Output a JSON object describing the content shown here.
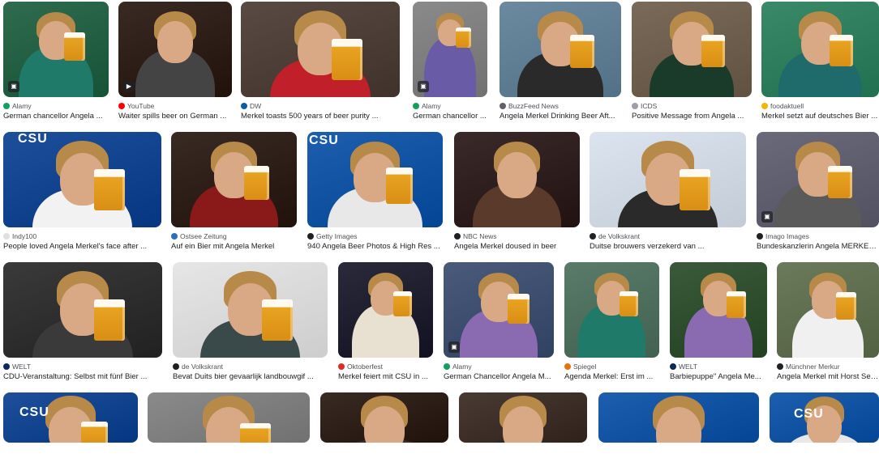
{
  "results": [
    {
      "source": "Alamy",
      "caption": "German chancellor Angela ...",
      "favicon_color": "#12a05c",
      "badge": "image",
      "bg": "#2f6b4e",
      "body": "#1f7a6a",
      "mug": true
    },
    {
      "source": "YouTube",
      "caption": "Waiter spills beer on German ...",
      "favicon_color": "#ff0000",
      "badge": "play",
      "bg": "#3a2a24",
      "body": "#444444",
      "mug": false
    },
    {
      "source": "DW",
      "caption": "Merkel toasts 500 years of beer purity ...",
      "favicon_color": "#0b5da8",
      "badge": "",
      "bg": "#5a4a44",
      "body": "#c0202a",
      "mug": true
    },
    {
      "source": "Alamy",
      "caption": "German chancellor ...",
      "favicon_color": "#12a05c",
      "badge": "image",
      "bg": "#8a8a8a",
      "body": "#6a5ba6",
      "mug": true
    },
    {
      "source": "BuzzFeed News",
      "caption": "Angela Merkel Drinking Beer Aft...",
      "favicon_color": "#5f6368",
      "badge": "",
      "bg": "#6b8aa0",
      "body": "#2a2a2a",
      "mug": true
    },
    {
      "source": "ICDS",
      "caption": "Positive Message from Angela ...",
      "favicon_color": "#9aa0a6",
      "badge": "",
      "bg": "#7a6a5a",
      "body": "#1a3a2a",
      "mug": true
    },
    {
      "source": "foodaktuell",
      "caption": "Merkel setzt auf deutsches Bier ...",
      "favicon_color": "#f4b400",
      "badge": "",
      "bg": "#3a8a6a",
      "body": "#1f6a6a",
      "mug": true
    },
    {
      "source": "Indy100",
      "caption": "People loved Angela Merkel's face after ...",
      "favicon_color": "#e0e0e0",
      "badge": "",
      "bg": "#1d4f9a",
      "body": "#f2f2f2",
      "mug": true
    },
    {
      "source": "Ostsee Zeitung",
      "caption": "Auf ein Bier mit Angela Merkel",
      "favicon_color": "#2a6fb8",
      "badge": "",
      "bg": "#3a2a24",
      "body": "#8a1a1a",
      "mug": true
    },
    {
      "source": "Getty Images",
      "caption": "940 Angela Beer Photos & High Res ...",
      "favicon_color": "#202124",
      "badge": "",
      "bg": "#1d5fae",
      "body": "#e8e8e8",
      "mug": true
    },
    {
      "source": "NBC News",
      "caption": "Angela Merkel doused in beer",
      "favicon_color": "#202124",
      "badge": "",
      "bg": "#3a2a2a",
      "body": "#5a3a2a",
      "mug": false
    },
    {
      "source": "de Volkskrant",
      "caption": "Duitse brouwers verzekerd van ...",
      "favicon_color": "#202124",
      "badge": "",
      "bg": "#dbe4ef",
      "body": "#2a2a2a",
      "mug": true
    },
    {
      "source": "Imago Images",
      "caption": "Bundeskanzlerin Angela MERKEL (C...",
      "favicon_color": "#202124",
      "badge": "image",
      "bg": "#6a6a7a",
      "body": "#5a5a5a",
      "mug": true
    },
    {
      "source": "WELT",
      "caption": "CDU-Veranstaltung: Selbst mit fünf Bier ...",
      "favicon_color": "#0b2a5a",
      "badge": "",
      "bg": "#3a3a3a",
      "body": "#3a3a3a",
      "mug": true
    },
    {
      "source": "de Volkskrant",
      "caption": "Bevat Duits bier gevaarlijk landbouwgif ...",
      "favicon_color": "#202124",
      "badge": "",
      "bg": "#e6e6e6",
      "body": "#3a4a4a",
      "mug": true
    },
    {
      "source": "Oktoberfest",
      "caption": "Merkel feiert mit CSU in ...",
      "favicon_color": "#d93025",
      "badge": "",
      "bg": "#2a2a3a",
      "body": "#e8e0d0",
      "mug": true
    },
    {
      "source": "Alamy",
      "caption": "German Chancellor Angela M...",
      "favicon_color": "#12a05c",
      "badge": "image",
      "bg": "#4a5a7a",
      "body": "#8a6ab0",
      "mug": true
    },
    {
      "source": "Spiegel",
      "caption": "Agenda Merkel: Erst im ...",
      "favicon_color": "#e8710a",
      "badge": "",
      "bg": "#5a7a6a",
      "body": "#1f7a6a",
      "mug": true
    },
    {
      "source": "WELT",
      "caption": "Barbiepuppe\" Angela Me...",
      "favicon_color": "#0b2a5a",
      "badge": "",
      "bg": "#3a5a3a",
      "body": "#8a6ab0",
      "mug": true
    },
    {
      "source": "Münchner Merkur",
      "caption": "Angela Merkel mit Horst Seehofer ...",
      "favicon_color": "#202124",
      "badge": "",
      "bg": "#6a7a5a",
      "body": "#f0f0f0",
      "mug": true
    },
    {
      "source": "",
      "caption": "",
      "favicon_color": "#ffffff",
      "badge": "",
      "bg": "#1d4f9a",
      "body": "#e8e8e8",
      "mug": true
    },
    {
      "source": "",
      "caption": "",
      "favicon_color": "#ffffff",
      "badge": "",
      "bg": "#8a8a8a",
      "body": "#2a2a2a",
      "mug": true
    },
    {
      "source": "",
      "caption": "",
      "favicon_color": "#ffffff",
      "badge": "",
      "bg": "#3a2a24",
      "body": "#3a2a2a",
      "mug": false
    },
    {
      "source": "",
      "caption": "",
      "favicon_color": "#ffffff",
      "badge": "",
      "bg": "#4a3a34",
      "body": "#2a2a2a",
      "mug": false
    },
    {
      "source": "",
      "caption": "",
      "favicon_color": "#ffffff",
      "badge": "",
      "bg": "#1d5fae",
      "body": "#e8e8e8",
      "mug": false
    },
    {
      "source": "",
      "caption": "",
      "favicon_color": "#ffffff",
      "badge": "",
      "bg": "#1d5fae",
      "body": "#e8e8e8",
      "mug": false
    }
  ],
  "csu_label": "CSU"
}
